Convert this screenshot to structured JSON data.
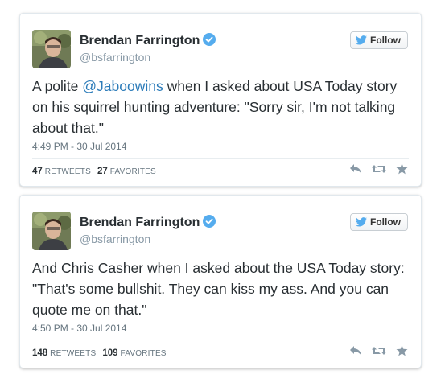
{
  "tweets": [
    {
      "name": "Brendan Farrington",
      "handle": "@bsfarrington",
      "follow_label": "Follow",
      "text_before": "A polite ",
      "mention": "@Jaboowins",
      "text_after": " when I asked about USA Today story on his squirrel hunting adventure: \"Sorry sir, I'm not talking about that.\"",
      "timestamp": "4:49 PM - 30 Jul 2014",
      "retweets": "47",
      "retweets_label": "RETWEETS",
      "favorites": "27",
      "favorites_label": "FAVORITES"
    },
    {
      "name": "Brendan Farrington",
      "handle": "@bsfarrington",
      "follow_label": "Follow",
      "text": "And Chris Casher when I asked about the USA Today story: \"That's some bullshit. They can kiss my ass. And you can quote me on that.\"",
      "timestamp": "4:50 PM - 30 Jul 2014",
      "retweets": "148",
      "retweets_label": "RETWEETS",
      "favorites": "109",
      "favorites_label": "FAVORITES"
    }
  ],
  "colors": {
    "link": "#2b7bb9",
    "verified": "#55acee",
    "twitter_bird": "#55acee",
    "text": "#292f33",
    "muted": "#66757f"
  },
  "icons": [
    "verified-badge-icon",
    "twitter-bird-icon",
    "reply-icon",
    "retweet-icon",
    "favorite-star-icon"
  ]
}
